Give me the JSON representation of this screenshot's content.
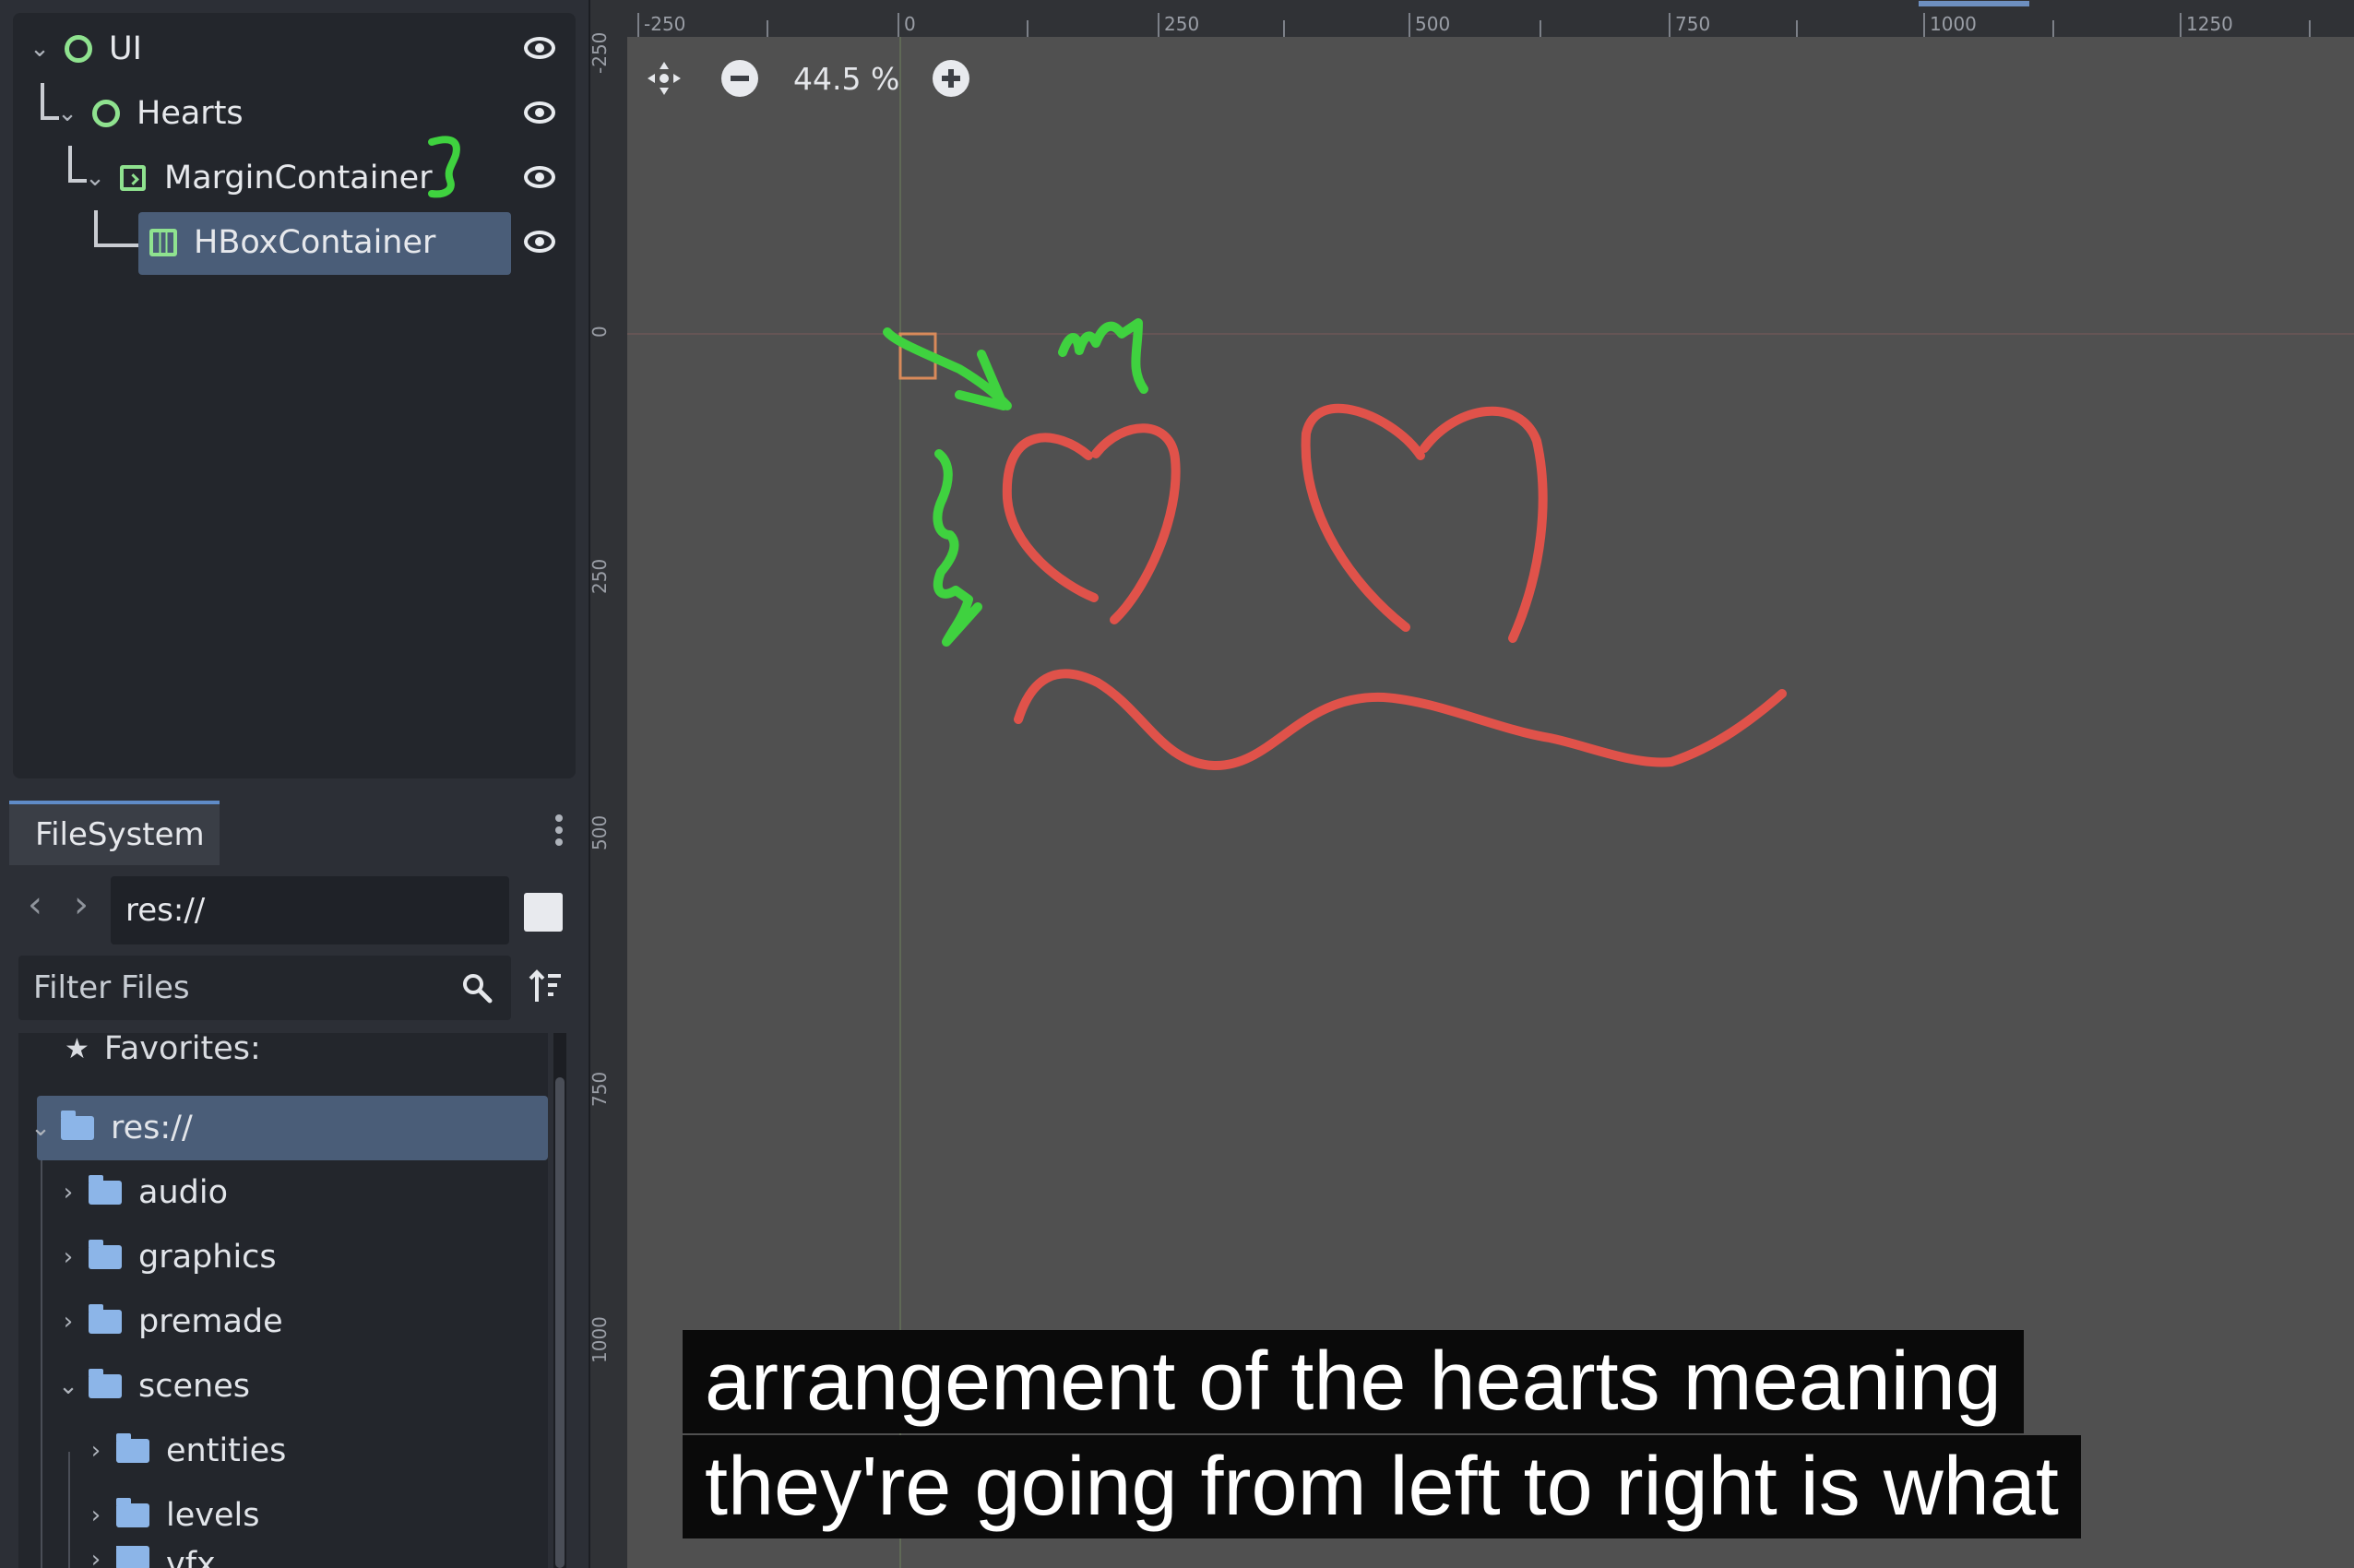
{
  "scene_tree": {
    "nodes": [
      {
        "label": "UI",
        "icon": "control-node-icon",
        "expanded": true
      },
      {
        "label": "Hearts",
        "icon": "control-node-icon",
        "expanded": true
      },
      {
        "label": "MarginContainer",
        "icon": "margin-container-icon",
        "expanded": true
      },
      {
        "label": "HBoxContainer",
        "icon": "hbox-container-icon",
        "selected": true
      }
    ]
  },
  "filesystem": {
    "tab_label": "FileSystem",
    "path": "res://",
    "filter_placeholder": "Filter Files",
    "favorites_label": "Favorites:",
    "root_label": "res://",
    "folders": [
      "audio",
      "graphics",
      "premade",
      "scenes"
    ],
    "scene_subfolders": [
      "entities",
      "levels",
      "vfx"
    ]
  },
  "viewport": {
    "zoom": "44.5 %",
    "ruler_h": [
      "-250",
      "0",
      "250",
      "500",
      "750",
      "1000",
      "1250"
    ],
    "ruler_v": [
      "-250",
      "0",
      "250",
      "500",
      "750",
      "1000"
    ],
    "annotation_colors": {
      "green": "#3fd23f",
      "red": "#e0524a"
    }
  },
  "subtitles": {
    "line1": "arrangement of the hearts meaning",
    "line2": "they're going from left to right is what"
  },
  "colors": {
    "selection": "#4a5d78",
    "node_green": "#8fe28f",
    "folder_blue": "#8cb5e8"
  }
}
